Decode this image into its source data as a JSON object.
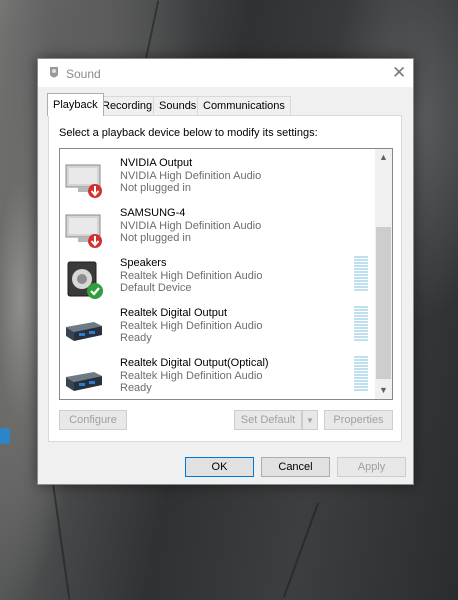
{
  "window": {
    "title": "Sound"
  },
  "tabs": [
    {
      "label": "Playback",
      "active": true
    },
    {
      "label": "Recording",
      "active": false
    },
    {
      "label": "Sounds",
      "active": false
    },
    {
      "label": "Communications",
      "active": false
    }
  ],
  "instruction": "Select a playback device below to modify its settings:",
  "devices": [
    {
      "name": "NVIDIA Output",
      "driver": "NVIDIA High Definition Audio",
      "status": "Not plugged in",
      "icon": "monitor-icon",
      "badge": "unplugged-red-arrow"
    },
    {
      "name": "SAMSUNG-4",
      "driver": "NVIDIA High Definition Audio",
      "status": "Not plugged in",
      "icon": "monitor-icon",
      "badge": "unplugged-red-arrow"
    },
    {
      "name": "Speakers",
      "driver": "Realtek High Definition Audio",
      "status": "Default Device",
      "icon": "speaker-icon",
      "badge": "default-green-check"
    },
    {
      "name": "Realtek Digital Output",
      "driver": "Realtek High Definition Audio",
      "status": "Ready",
      "icon": "digital-output-icon",
      "badge": "none"
    },
    {
      "name": "Realtek Digital Output(Optical)",
      "driver": "Realtek High Definition Audio",
      "status": "Ready",
      "icon": "digital-output-icon",
      "badge": "none"
    }
  ],
  "buttons": {
    "configure": "Configure",
    "set_default": "Set Default",
    "properties": "Properties",
    "ok": "OK",
    "cancel": "Cancel",
    "apply": "Apply"
  },
  "colors": {
    "accent": "#0078d7",
    "meter": "#bfe0ee",
    "unplugged": "#d32f2f",
    "default_check": "#2e9e3f"
  }
}
